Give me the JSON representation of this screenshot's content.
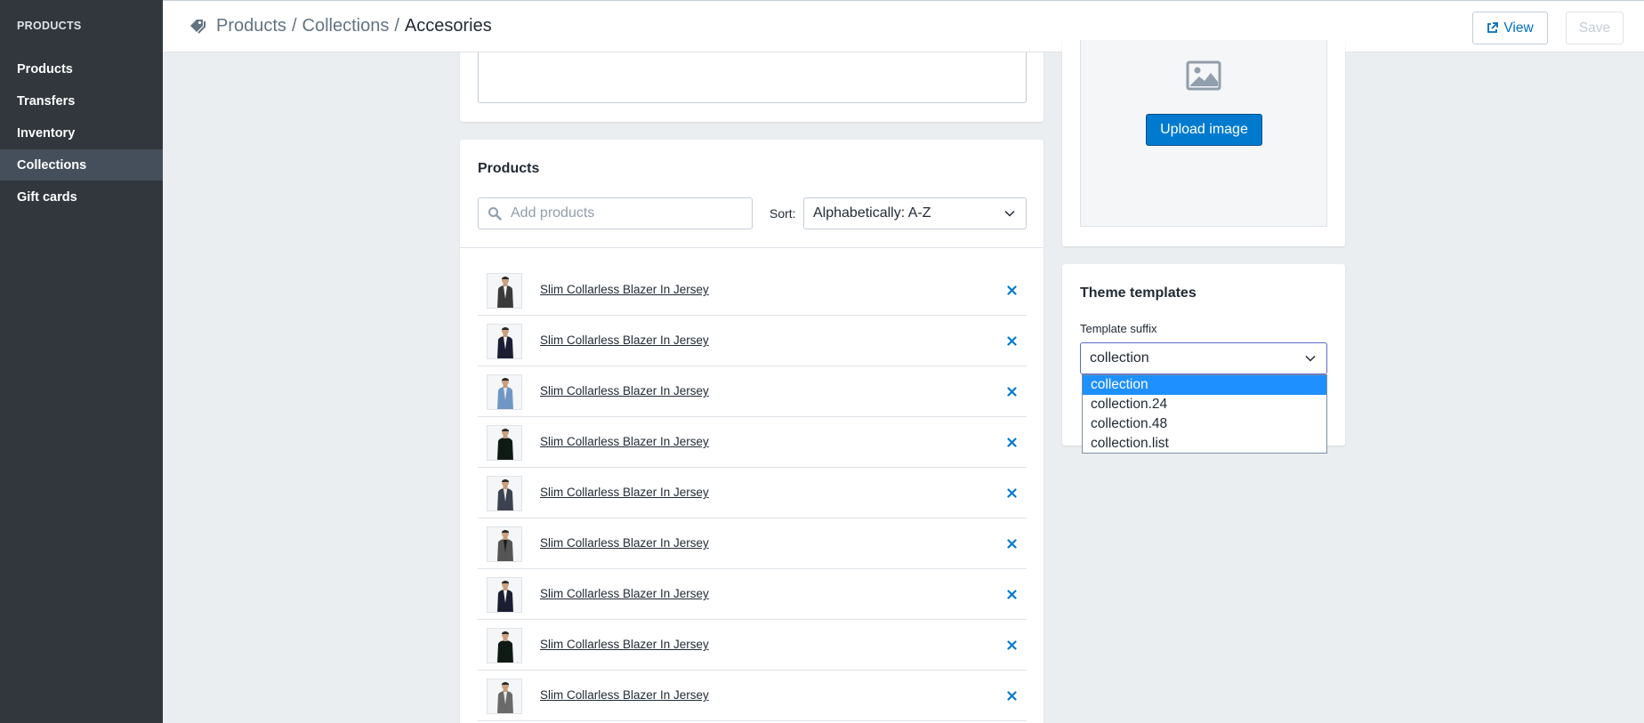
{
  "sidebar": {
    "section_title": "PRODUCTS",
    "items": [
      {
        "label": "Products"
      },
      {
        "label": "Transfers"
      },
      {
        "label": "Inventory"
      },
      {
        "label": "Collections"
      },
      {
        "label": "Gift cards"
      }
    ],
    "active_index": 3
  },
  "header": {
    "breadcrumb": [
      "Products",
      "/",
      "Collections",
      "/",
      "Accesories"
    ],
    "view_label": "View",
    "save_label": "Save"
  },
  "products_card": {
    "title": "Products",
    "search_placeholder": "Add products",
    "sort_label": "Sort:",
    "sort_value": "Alphabetically: A-Z",
    "items": [
      {
        "name": "Slim Collarless Blazer In Jersey",
        "jacket_color": "#3a3a3a",
        "shirt_color": "#f2f2f2"
      },
      {
        "name": "Slim Collarless Blazer In Jersey",
        "jacket_color": "#1b1e33",
        "shirt_color": "#f2f2f2"
      },
      {
        "name": "Slim Collarless Blazer In Jersey",
        "jacket_color": "#6f97c5",
        "shirt_color": "#e8e8e8"
      },
      {
        "name": "Slim Collarless Blazer In Jersey",
        "jacket_color": "#0f1a14",
        "shirt_color": "#0f1a14"
      },
      {
        "name": "Slim Collarless Blazer In Jersey",
        "jacket_color": "#3d4250",
        "shirt_color": "#e8e8e8"
      },
      {
        "name": "Slim Collarless Blazer In Jersey",
        "jacket_color": "#555555",
        "shirt_color": "#1a1a1a"
      },
      {
        "name": "Slim Collarless Blazer In Jersey",
        "jacket_color": "#1b1e33",
        "shirt_color": "#f2f2f2"
      },
      {
        "name": "Slim Collarless Blazer In Jersey",
        "jacket_color": "#0f1a14",
        "shirt_color": "#0f1a14"
      },
      {
        "name": "Slim Collarless Blazer In Jersey",
        "jacket_color": "#6a6a6a",
        "shirt_color": "#e8e8e8"
      }
    ]
  },
  "image_card": {
    "upload_label": "Upload image"
  },
  "theme_card": {
    "title": "Theme templates",
    "field_label": "Template suffix",
    "selected_value": "collection",
    "options": [
      "collection",
      "collection.24",
      "collection.48",
      "collection.list"
    ]
  },
  "colors": {
    "accent": "#007ace",
    "link_icon": "#006fbb",
    "sidebar_bg": "#31373d"
  }
}
